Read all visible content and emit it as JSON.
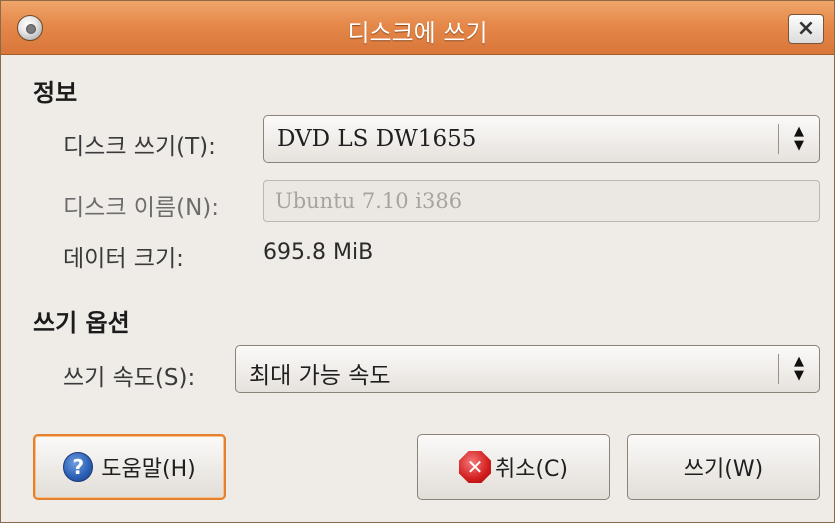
{
  "window": {
    "title": "디스크에 쓰기",
    "close_label": "×"
  },
  "info_section": {
    "title": "정보",
    "write_disc_label": "디스크 쓰기(T):",
    "write_disc_value": "DVD LS DW1655",
    "disc_name_label": "디스크 이름(N):",
    "disc_name_value": "Ubuntu 7.10 i386",
    "data_size_label": "데이터 크기:",
    "data_size_value": "695.8 MiB"
  },
  "options_section": {
    "title": "쓰기 옵션",
    "write_speed_label": "쓰기 속도(S):",
    "write_speed_value": "최대 가능 속도"
  },
  "buttons": {
    "help_label": "도움말(H)",
    "cancel_label": "취소(C)",
    "write_label": "쓰기(W)"
  },
  "icons": {
    "app": "disc-icon",
    "help": "help-icon",
    "cancel": "cancel-icon",
    "close": "close-icon",
    "combo_arrows": "up-down-arrows-icon"
  },
  "colors": {
    "titlebar": "#e5884a",
    "focus_ring": "#e4812f",
    "window_bg": "#efebe7"
  }
}
